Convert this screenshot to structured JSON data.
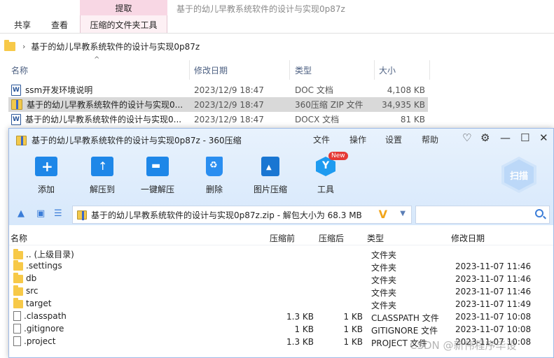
{
  "explorer": {
    "ribbon": {
      "context_group": "提取",
      "context_tab": "压缩的文件夹工具",
      "tabs": [
        "共享",
        "查看"
      ],
      "window_title": "基于的幼儿早教系统软件的设计与实现0p87z"
    },
    "address": {
      "path": "基于的幼儿早教系统软件的设计与实现0p87z"
    },
    "columns": {
      "name": "名称",
      "date": "修改日期",
      "type": "类型",
      "size": "大小"
    },
    "files": [
      {
        "name": "ssm开发环境说明",
        "date": "2023/12/9 18:47",
        "type": "DOC 文档",
        "size": "4,108 KB",
        "icon": "word-doc-icon"
      },
      {
        "name": "基于的幼儿早教系统软件的设计与实现0...",
        "date": "2023/12/9 18:47",
        "type": "360压缩 ZIP 文件",
        "size": "34,935 KB",
        "icon": "zip-icon"
      },
      {
        "name": "基于的幼儿早教系统软件的设计与实现0...",
        "date": "2023/12/9 18:47",
        "type": "DOCX 文档",
        "size": "81 KB",
        "icon": "word-doc-icon"
      }
    ]
  },
  "zip": {
    "title": "基于的幼儿早教系统软件的设计与实现0p87z - 360压缩",
    "menu": [
      "文件",
      "操作",
      "设置",
      "帮助"
    ],
    "toolbar": [
      {
        "label": "添加",
        "icon": "add-icon"
      },
      {
        "label": "解压到",
        "icon": "extract-icon"
      },
      {
        "label": "一键解压",
        "icon": "one-click-extract-icon"
      },
      {
        "label": "删除",
        "icon": "delete-icon"
      },
      {
        "label": "图片压缩",
        "icon": "image-compress-icon"
      },
      {
        "label": "工具",
        "icon": "tools-icon"
      }
    ],
    "new_badge": "New",
    "scan_label": "扫描",
    "address": "基于的幼儿早教系统软件的设计与实现0p87z.zip - 解包大小为 68.3 MB",
    "search": {
      "value": "",
      "placeholder": ""
    },
    "columns": {
      "name": "名称",
      "compressed": "压缩前",
      "packed": "压缩后",
      "type": "类型",
      "date": "修改日期"
    },
    "rows": [
      {
        "name": ".. (上级目录)",
        "before": "",
        "after": "",
        "type": "文件夹",
        "date": "",
        "kind": "folder"
      },
      {
        "name": ".settings",
        "before": "",
        "after": "",
        "type": "文件夹",
        "date": "2023-11-07 11:46",
        "kind": "folder"
      },
      {
        "name": "db",
        "before": "",
        "after": "",
        "type": "文件夹",
        "date": "2023-11-07 11:46",
        "kind": "folder"
      },
      {
        "name": "src",
        "before": "",
        "after": "",
        "type": "文件夹",
        "date": "2023-11-07 11:46",
        "kind": "folder"
      },
      {
        "name": "target",
        "before": "",
        "after": "",
        "type": "文件夹",
        "date": "2023-11-07 11:49",
        "kind": "folder"
      },
      {
        "name": ".classpath",
        "before": "1.3 KB",
        "after": "1 KB",
        "type": "CLASSPATH 文件",
        "date": "2023-11-07 10:08",
        "kind": "file"
      },
      {
        "name": ".gitignore",
        "before": "1 KB",
        "after": "1 KB",
        "type": "GITIGNORE 文件",
        "date": "2023-11-07 10:08",
        "kind": "file"
      },
      {
        "name": ".project",
        "before": "1.3 KB",
        "after": "1 KB",
        "type": "PROJECT 文件",
        "date": "2023-11-07 10:08",
        "kind": "file"
      }
    ]
  },
  "watermark": "CSDN @新伟程序毕设"
}
